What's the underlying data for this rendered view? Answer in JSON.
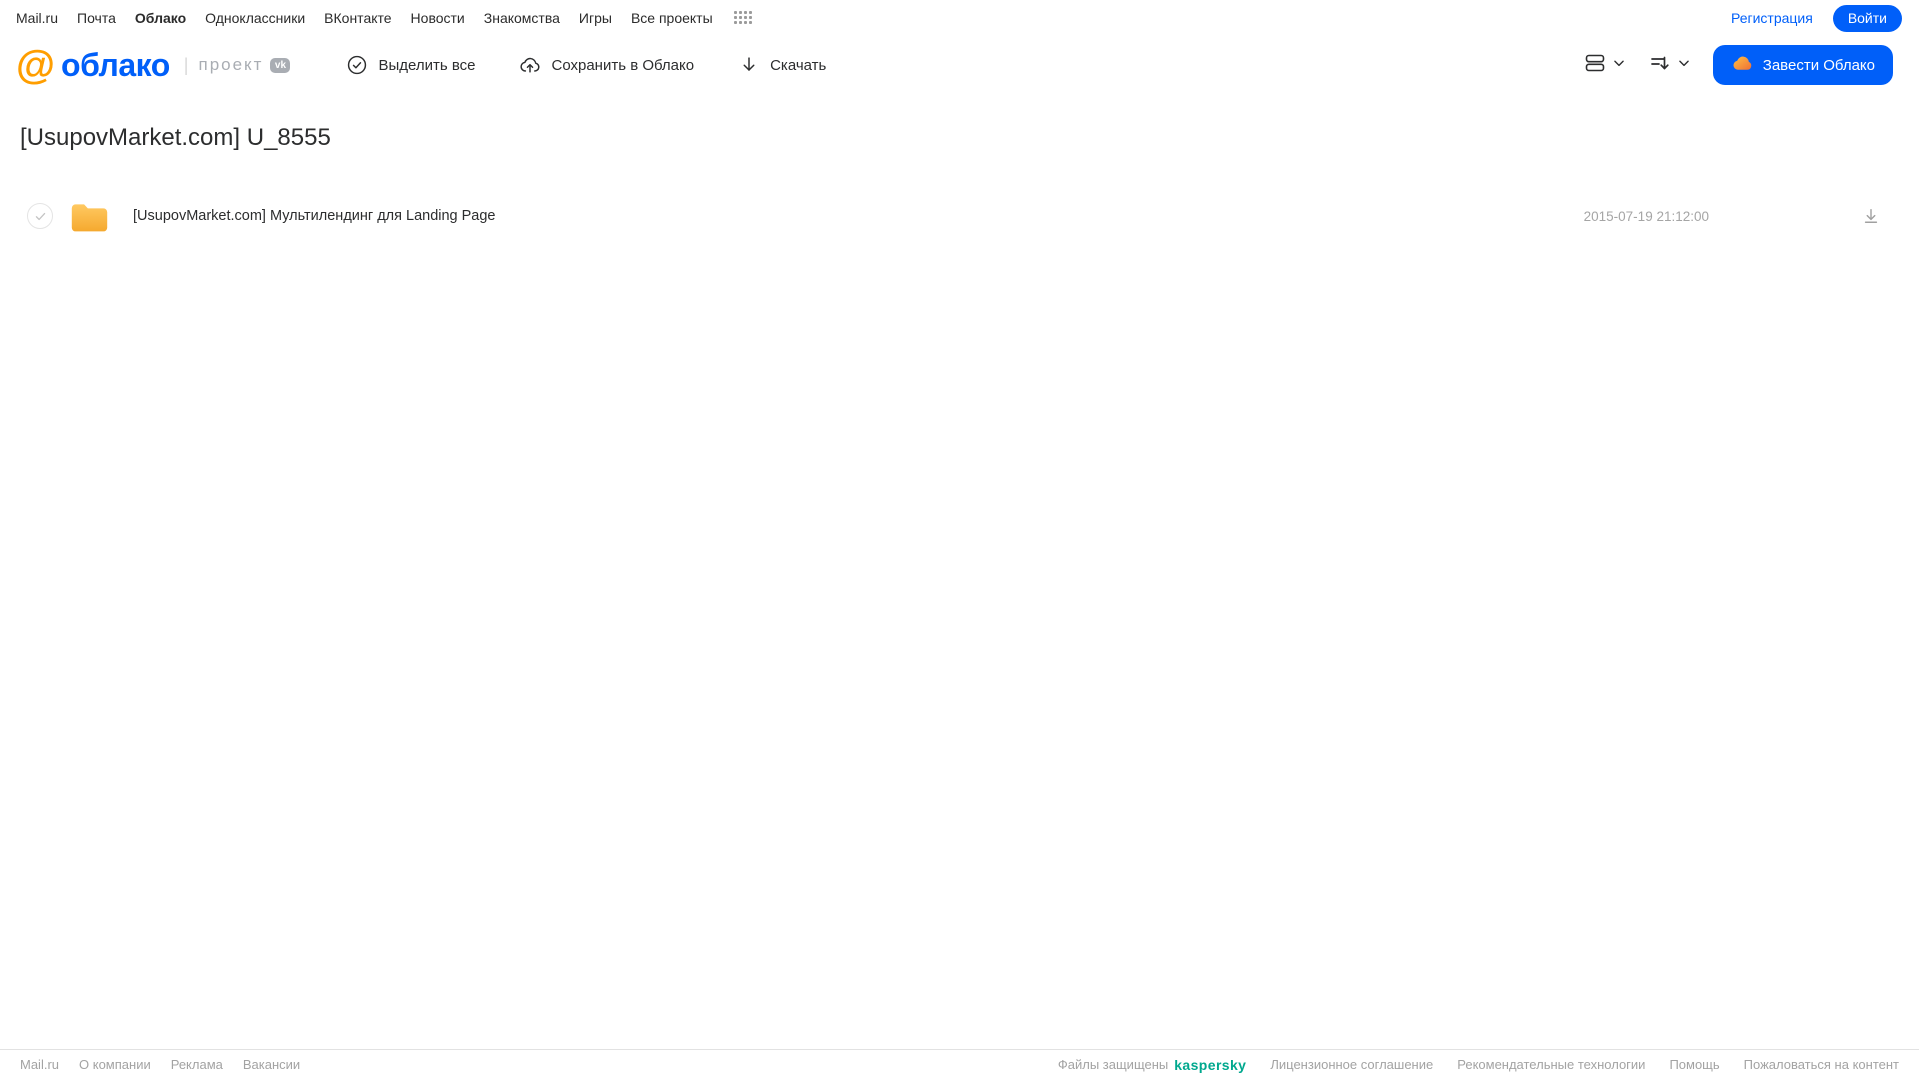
{
  "topnav": {
    "items": [
      "Mail.ru",
      "Почта",
      "Облако",
      "Одноклассники",
      "ВКонтакте",
      "Новости",
      "Знакомства",
      "Игры",
      "Все проекты"
    ],
    "active_item": "Облако",
    "registration_label": "Регистрация",
    "login_label": "Войти"
  },
  "header": {
    "logo_at": "@",
    "logo_text": "облако",
    "project_label": "проект",
    "vk_badge": "vk",
    "toolbar": {
      "select_all": "Выделить все",
      "save_to_cloud": "Сохранить в Облако",
      "download": "Скачать"
    },
    "get_cloud_button": "Завести Облако"
  },
  "main": {
    "title": "[UsupovMarket.com] U_8555",
    "files": [
      {
        "type": "folder",
        "name": "[UsupovMarket.com] Мультилендинг для Landing Page",
        "date": "2015-07-19 21:12:00"
      }
    ]
  },
  "footer": {
    "left_links": [
      "Mail.ru",
      "О компании",
      "Реклама",
      "Вакансии"
    ],
    "protected_prefix": "Файлы защищены",
    "kaspersky_label": "kaspersky",
    "right_links": [
      "Лицензионное соглашение",
      "Рекомендательные технологии",
      "Помощь",
      "Пожаловаться на контент"
    ]
  },
  "icons": [
    "apps-grid-icon",
    "check-circle-icon",
    "cloud-upload-icon",
    "download-icon",
    "view-toggle-icon",
    "sort-icon",
    "chevron-down-icon",
    "cloud-icon",
    "folder-icon",
    "download-underline-icon",
    "checkmark-icon"
  ],
  "colors": {
    "accent_blue": "#005FF9",
    "logo_orange": "#FF9E00",
    "folder_top": "#FFC961",
    "folder_bottom": "#F5A92F",
    "kaspersky_teal": "#00A88E",
    "muted_text": "#A5A5A5"
  }
}
